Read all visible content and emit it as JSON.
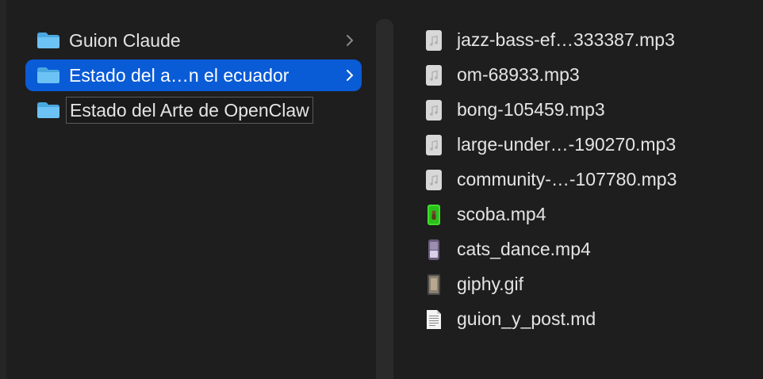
{
  "folders": [
    {
      "label": "Guion Claude",
      "selected": false
    },
    {
      "label": "Estado del a…n el ecuador",
      "selected": true
    },
    {
      "label": "Estado del Arte de OpenClaw",
      "editing": true
    }
  ],
  "files": [
    {
      "name": "jazz-bass-ef…333387.mp3",
      "icon": "audio-file-icon"
    },
    {
      "name": "om-68933.mp3",
      "icon": "audio-file-icon"
    },
    {
      "name": "bong-105459.mp3",
      "icon": "audio-file-icon"
    },
    {
      "name": "large-under…-190270.mp3",
      "icon": "audio-file-icon"
    },
    {
      "name": "community-…-107780.mp3",
      "icon": "audio-file-icon"
    },
    {
      "name": "scoba.mp4",
      "icon": "video-thumbnail-icon"
    },
    {
      "name": "cats_dance.mp4",
      "icon": "video-thumbnail-icon"
    },
    {
      "name": "giphy.gif",
      "icon": "gif-thumbnail-icon"
    },
    {
      "name": "guion_y_post.md",
      "icon": "text-document-icon"
    }
  ],
  "colors": {
    "background": "#1e1e1e",
    "selection": "#0a5bd6",
    "folder": "#5ab8f0",
    "text": "#e4e4e4"
  }
}
